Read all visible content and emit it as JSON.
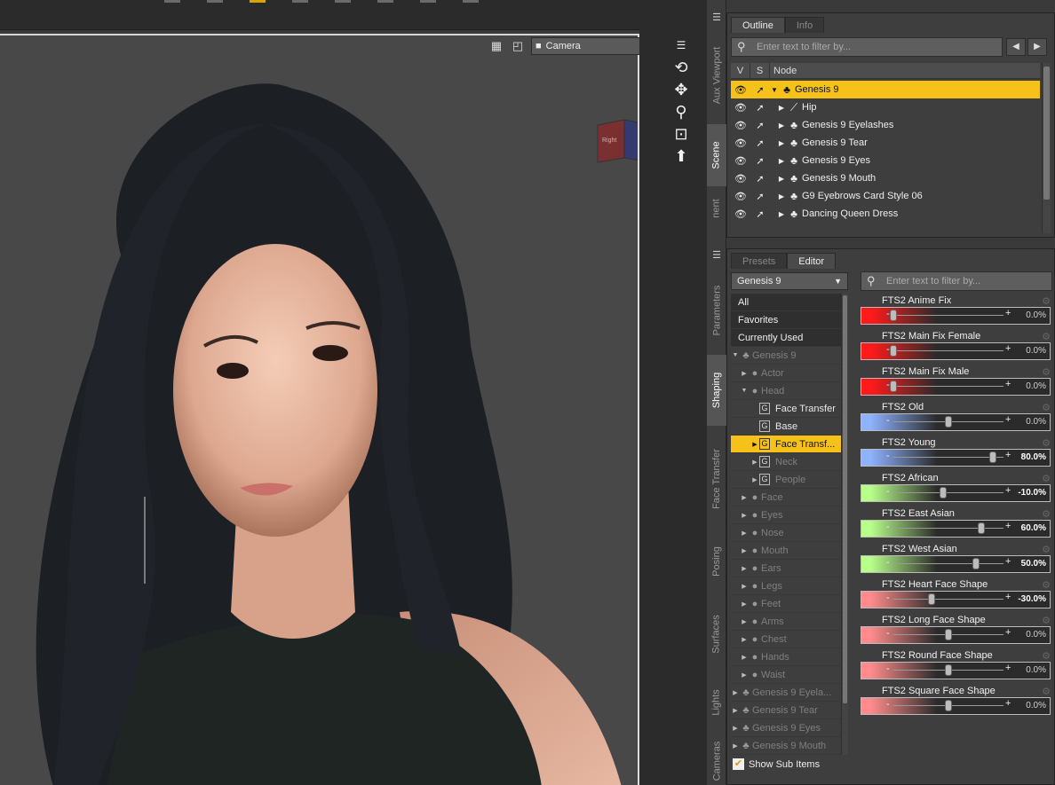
{
  "viewport": {
    "camera_label": "Camera",
    "navcube_label": "Right"
  },
  "side_tabs": [
    {
      "label": "Aux Viewport"
    },
    {
      "label": "Scene"
    },
    {
      "label": "nent"
    },
    {
      "label": "Parameters"
    },
    {
      "label": "Shaping"
    },
    {
      "label": "Face Transfer"
    },
    {
      "label": "Posing"
    },
    {
      "label": "Surfaces"
    },
    {
      "label": "Lights"
    },
    {
      "label": "Cameras"
    }
  ],
  "scene_pane": {
    "tabs": [
      "Outline",
      "Info"
    ],
    "filter_placeholder": "Enter text to filter by...",
    "columns": [
      "V",
      "S",
      "Node"
    ],
    "nodes": [
      {
        "name": "Genesis 9",
        "icon": "figure-icon",
        "selected": true
      },
      {
        "name": "Hip",
        "icon": "bone-icon"
      },
      {
        "name": "Genesis 9 Eyelashes",
        "icon": "figure-icon"
      },
      {
        "name": "Genesis 9 Tear",
        "icon": "figure-icon"
      },
      {
        "name": "Genesis 9 Eyes",
        "icon": "figure-icon"
      },
      {
        "name": "Genesis 9 Mouth",
        "icon": "figure-icon"
      },
      {
        "name": "G9 Eyebrows Card Style 06",
        "icon": "figure-icon"
      },
      {
        "name": "Dancing Queen Dress",
        "icon": "figure-icon"
      }
    ]
  },
  "editor_pane": {
    "tabs": [
      "Presets",
      "Editor"
    ],
    "figure_select": "Genesis 9",
    "filter_placeholder": "Enter text to filter by...",
    "tree": [
      {
        "label": "All"
      },
      {
        "label": "Favorites"
      },
      {
        "label": "Currently Used"
      },
      {
        "label": "Genesis 9"
      },
      {
        "label": "Actor"
      },
      {
        "label": "Head"
      },
      {
        "label": "Face Transfer"
      },
      {
        "label": "Base"
      },
      {
        "label": "Face Transf..."
      },
      {
        "label": "Neck"
      },
      {
        "label": "People"
      },
      {
        "label": "Face"
      },
      {
        "label": "Eyes"
      },
      {
        "label": "Nose"
      },
      {
        "label": "Mouth"
      },
      {
        "label": "Ears"
      },
      {
        "label": "Legs"
      },
      {
        "label": "Feet"
      },
      {
        "label": "Arms"
      },
      {
        "label": "Chest"
      },
      {
        "label": "Hands"
      },
      {
        "label": "Waist"
      },
      {
        "label": "Genesis 9 Eyela..."
      },
      {
        "label": "Genesis 9 Tear"
      },
      {
        "label": "Genesis 9 Eyes"
      },
      {
        "label": "Genesis 9 Mouth"
      }
    ],
    "show_sub_items": "Show Sub Items",
    "params": [
      {
        "name": "FTS2 Anime Fix",
        "value": "0.0%",
        "fraction": 0.0,
        "color": "#ff1a1a"
      },
      {
        "name": "FTS2 Main Fix Female",
        "value": "0.0%",
        "fraction": 0.0,
        "color": "#ff1a1a"
      },
      {
        "name": "FTS2 Main Fix Male",
        "value": "0.0%",
        "fraction": 0.0,
        "color": "#ff1a1a"
      },
      {
        "name": "FTS2 Old",
        "value": "0.0%",
        "fraction": 0.5,
        "color": "#8fb2ff"
      },
      {
        "name": "FTS2 Young",
        "value": "80.0%",
        "fraction": 0.9,
        "color": "#8fb2ff"
      },
      {
        "name": "FTS2 African",
        "value": "-10.0%",
        "fraction": 0.45,
        "color": "#b8ff8a"
      },
      {
        "name": "FTS2 East Asian",
        "value": "60.0%",
        "fraction": 0.8,
        "color": "#b8ff8a"
      },
      {
        "name": "FTS2 West Asian",
        "value": "50.0%",
        "fraction": 0.75,
        "color": "#b8ff8a"
      },
      {
        "name": "FTS2 Heart Face Shape",
        "value": "-30.0%",
        "fraction": 0.35,
        "color": "#ff8c8c"
      },
      {
        "name": "FTS2 Long Face Shape",
        "value": "0.0%",
        "fraction": 0.5,
        "color": "#ff8c8c"
      },
      {
        "name": "FTS2 Round Face Shape",
        "value": "0.0%",
        "fraction": 0.5,
        "color": "#ff8c8c"
      },
      {
        "name": "FTS2 Square Face Shape",
        "value": "0.0%",
        "fraction": 0.5,
        "color": "#ff8c8c"
      }
    ]
  }
}
